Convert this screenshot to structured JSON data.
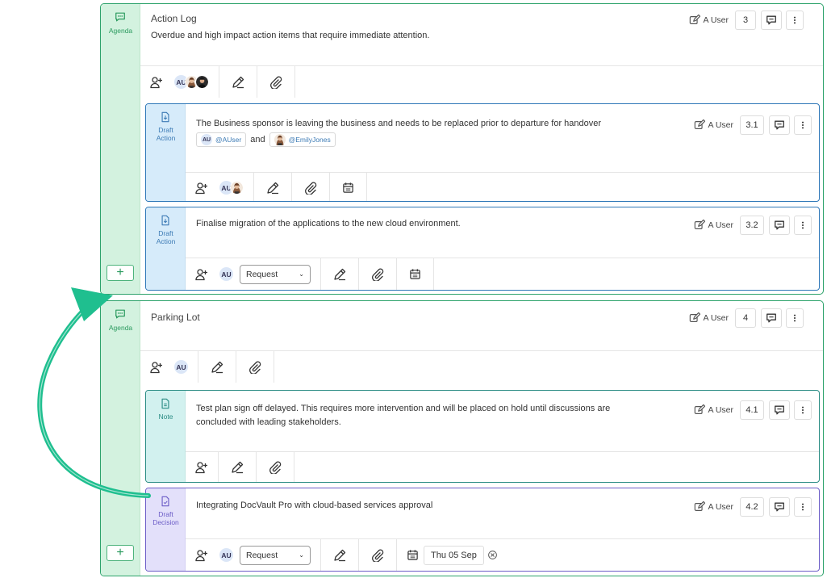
{
  "agendas": [
    {
      "side_label": "Agenda",
      "title": "Action Log",
      "description": "Overdue and high impact action items that require immediate attention.",
      "author": "A User",
      "number": "3",
      "add_label": "+",
      "assignee_initials": "AU",
      "cards": [
        {
          "type_label_1": "Draft",
          "type_label_2": "Action",
          "text": "The Business sponsor is leaving the business and needs to be replaced prior to departure for handover",
          "mention_1": "@AUser",
          "mention_1_initials": "AU",
          "and_text": "and",
          "mention_2": "@EmilyJones",
          "author": "A User",
          "number": "3.1",
          "assignee_initials": "AU"
        },
        {
          "type_label_1": "Draft",
          "type_label_2": "Action",
          "text": "Finalise migration of the applications to the new cloud environment.",
          "author": "A User",
          "number": "3.2",
          "assignee_initials": "AU",
          "select_value": "Request"
        }
      ]
    },
    {
      "side_label": "Agenda",
      "title": "Parking Lot",
      "author": "A User",
      "number": "4",
      "add_label": "+",
      "assignee_initials": "AU",
      "cards": [
        {
          "type_label_1": "Note",
          "text_line_1": "Test plan sign off delayed. This requires more intervention and will be placed on hold until discussions are",
          "text_line_2": "concluded with leading stakeholders.",
          "author": "A User",
          "number": "4.1"
        },
        {
          "type_label_1": "Draft",
          "type_label_2": "Decision",
          "text": "Integrating DocVault Pro with cloud-based services approval",
          "author": "A User",
          "number": "4.2",
          "assignee_initials": "AU",
          "select_value": "Request",
          "date": "Thu 05 Sep"
        }
      ]
    }
  ],
  "icons": {
    "agenda": "chat-dots-icon",
    "author": "edit-square-icon",
    "comment": "comment-icon",
    "more": "kebab-menu-icon",
    "add_person": "add-person-icon",
    "edit": "pencil-icon",
    "attach": "paperclip-icon",
    "calendar": "calendar-icon",
    "clear": "circle-x-icon"
  },
  "colors": {
    "agenda_border": "#2ea36c",
    "agenda_side": "#d3f2df",
    "action_border": "#2f78b8",
    "action_side": "#d6ebfa",
    "note_border": "#2a8c84",
    "note_side": "#d2f1ef",
    "decision_border": "#6c5dc7",
    "decision_side": "#e3e0fa",
    "arrow": "#1fbf8f"
  }
}
